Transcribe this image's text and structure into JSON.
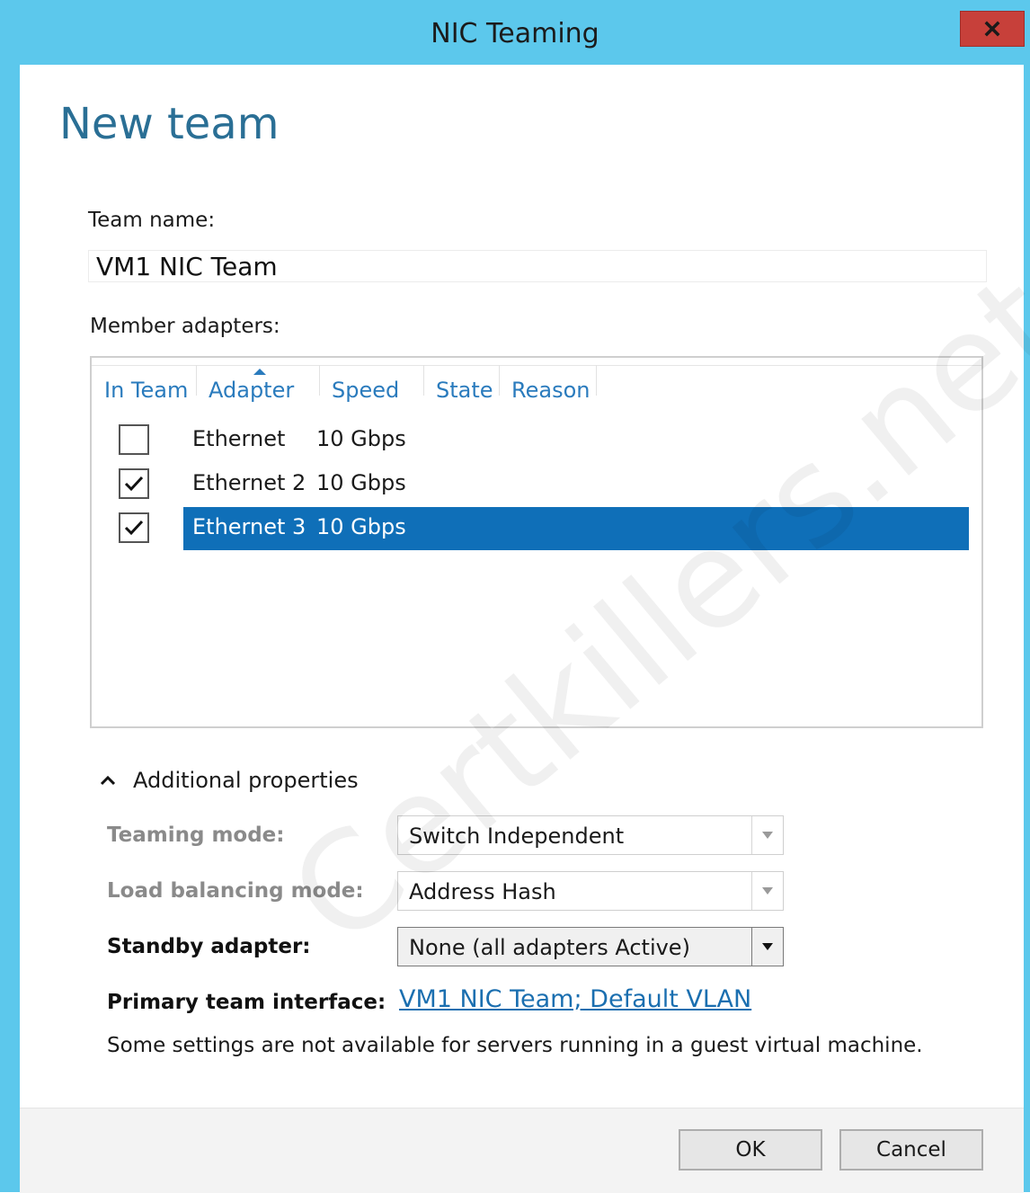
{
  "window": {
    "title": "NIC Teaming"
  },
  "page": {
    "heading": "New team"
  },
  "team_name": {
    "label": "Team name:",
    "value": "VM1 NIC Team"
  },
  "member_adapters": {
    "label": "Member adapters:",
    "columns": [
      "In Team",
      "Adapter",
      "Speed",
      "State",
      "Reason"
    ],
    "sorted_by": "Adapter",
    "rows": [
      {
        "in_team": false,
        "adapter": "Ethernet",
        "speed": "10 Gbps",
        "state": "",
        "reason": "",
        "selected": false
      },
      {
        "in_team": true,
        "adapter": "Ethernet 2",
        "speed": "10 Gbps",
        "state": "",
        "reason": "",
        "selected": false
      },
      {
        "in_team": true,
        "adapter": "Ethernet 3",
        "speed": "10 Gbps",
        "state": "",
        "reason": "",
        "selected": true
      }
    ]
  },
  "additional_properties": {
    "toggle_label": "Additional properties",
    "expanded": true,
    "teaming_mode": {
      "label": "Teaming mode:",
      "value": "Switch Independent"
    },
    "load_balancing_mode": {
      "label": "Load balancing mode:",
      "value": "Address Hash"
    },
    "standby_adapter": {
      "label": "Standby adapter:",
      "value": "None (all adapters Active)"
    },
    "primary_team_interface": {
      "label": "Primary team interface:",
      "value": "VM1 NIC Team; Default VLAN"
    },
    "note": "Some settings are not available for servers running in a guest virtual machine."
  },
  "buttons": {
    "ok": "OK",
    "cancel": "Cancel"
  },
  "watermark": "Certkillers.net",
  "colors": {
    "titlebar": "#5cc8ec",
    "close": "#c7403a",
    "selection": "#0f6fb8",
    "link": "#1b6fb0",
    "heading": "#2a6f95"
  }
}
